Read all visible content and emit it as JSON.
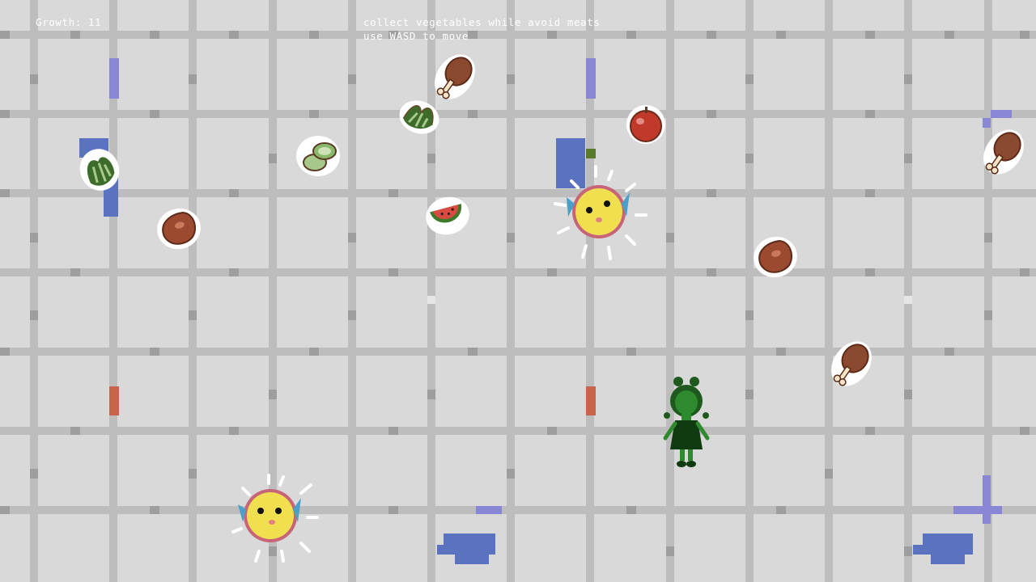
{
  "hud": {
    "growth_label": "Growth:",
    "growth_value": "11",
    "instruction_line1": "collect vegetables while avoid meats",
    "instruction_line2": "use WASD to move"
  },
  "colors": {
    "floor": "#d9d9d9",
    "grid_line": "#bdbdbd",
    "grid_node": "#9e9e9e",
    "water": "#5b72c0",
    "purple": "#8a86d6",
    "brick": "#c8644a",
    "player": "#2e7d2e",
    "puffer_body": "#f0e050",
    "meat": "#8b4a30"
  },
  "items": {
    "vegetables": [
      "bok-choy",
      "bok-choy",
      "cucumber",
      "apple",
      "watermelon"
    ],
    "meats": [
      "chicken-leg",
      "chicken-leg",
      "chicken-leg",
      "steak",
      "steak"
    ],
    "enemies": [
      "pufferfish",
      "pufferfish"
    ]
  }
}
